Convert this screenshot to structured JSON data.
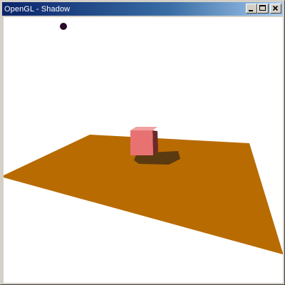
{
  "window": {
    "title": "OpenGL - Shadow"
  },
  "scene": {
    "light_icon": "light-source-dot",
    "colors": {
      "background": "#ffffff",
      "floor": "#b86b00",
      "shadow": "#5a3a10",
      "cube_front": "#e87272",
      "cube_top": "#f3a0a0",
      "cube_side": "#6b2a2a",
      "light": "#2a0a2a"
    }
  }
}
